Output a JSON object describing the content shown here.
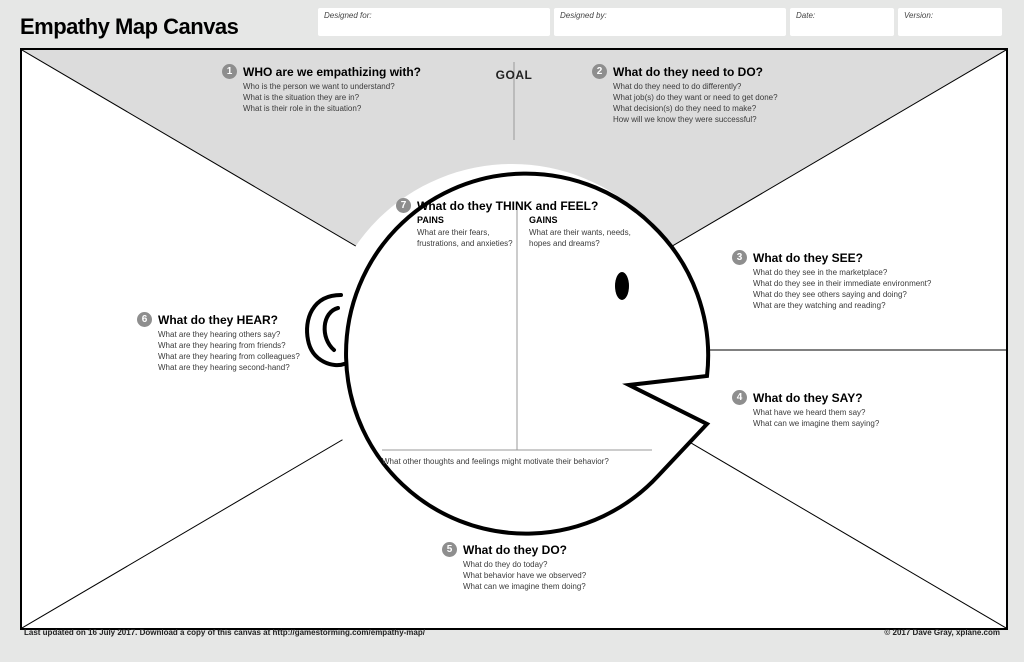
{
  "title": "Empathy Map Canvas",
  "fields": {
    "designed_for": "Designed for:",
    "designed_by": "Designed by:",
    "date": "Date:",
    "version": "Version:"
  },
  "goal_label": "GOAL",
  "sections": {
    "s1": {
      "num": "1",
      "heading": "WHO are we empathizing with?",
      "q1": "Who is the person we want to understand?",
      "q2": "What is the situation they are in?",
      "q3": "What is their role in the situation?"
    },
    "s2": {
      "num": "2",
      "heading": "What do they need to DO?",
      "q1": "What do they need to do differently?",
      "q2": "What job(s) do they want or need to get done?",
      "q3": "What decision(s) do they need to make?",
      "q4": "How will we know they were successful?"
    },
    "s3": {
      "num": "3",
      "heading": "What do they SEE?",
      "q1": "What do they see in the marketplace?",
      "q2": "What do they see in their immediate environment?",
      "q3": "What do they see others saying and doing?",
      "q4": "What are they watching and reading?"
    },
    "s4": {
      "num": "4",
      "heading": "What do they SAY?",
      "q1": "What have we heard them say?",
      "q2": "What can we imagine them saying?"
    },
    "s5": {
      "num": "5",
      "heading": "What do they DO?",
      "q1": "What do they do today?",
      "q2": "What behavior have we observed?",
      "q3": "What can we imagine them doing?"
    },
    "s6": {
      "num": "6",
      "heading": "What do they HEAR?",
      "q1": "What are they hearing others say?",
      "q2": "What are they hearing from friends?",
      "q3": "What are they hearing from colleagues?",
      "q4": "What are they hearing second-hand?"
    },
    "s7": {
      "num": "7",
      "heading": "What do they THINK and FEEL?",
      "pains_h": "PAINS",
      "pains_q": "What are their fears, frustrations, and anxieties?",
      "gains_h": "GAINS",
      "gains_q": "What are their wants, needs, hopes and dreams?",
      "bottom_q": "What other thoughts and feelings might motivate their behavior?"
    }
  },
  "footer": {
    "updated": "Last updated on 16 July 2017. Download a copy of this canvas at http://gamestorming.com/empathy-map/",
    "copyright": "© 2017 Dave Gray, xplane.com"
  }
}
